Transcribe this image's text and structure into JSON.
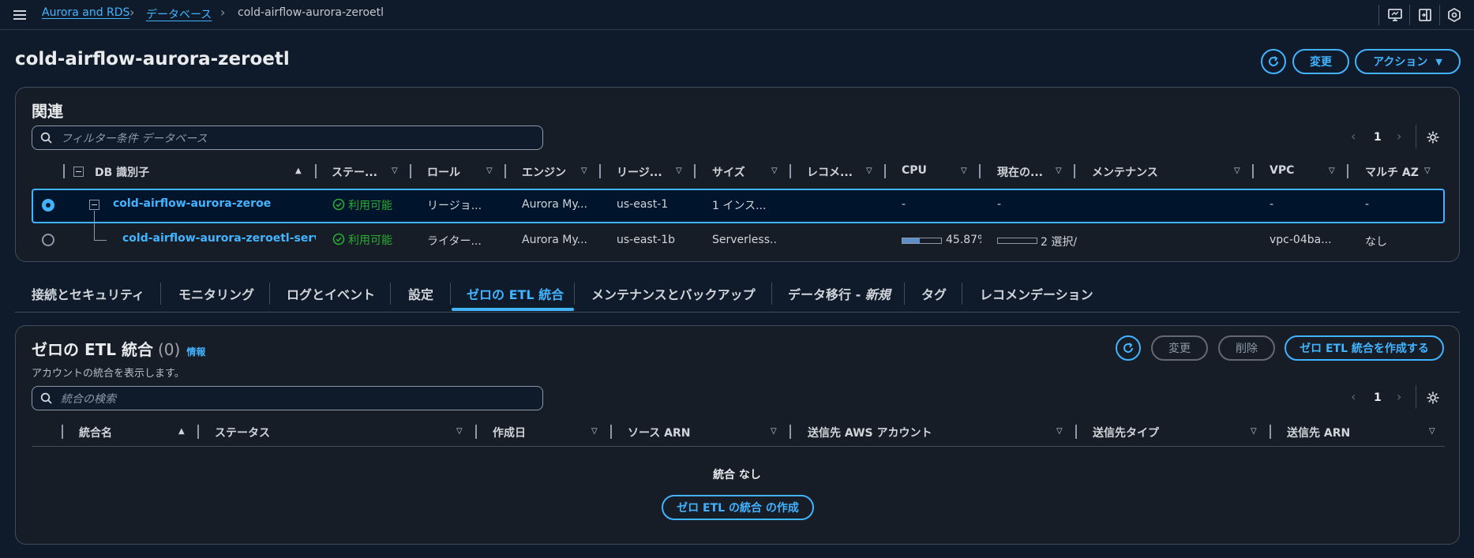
{
  "breadcrumb": {
    "items": [
      "Aurora and RDS",
      "データベース"
    ],
    "current": "cold-airflow-aurora-zeroetl"
  },
  "page": {
    "title": "cold-airflow-aurora-zeroetl",
    "modify_label": "変更",
    "actions_label": "アクション"
  },
  "related": {
    "title": "関連",
    "search_placeholder": "フィルター条件 データベース",
    "page_number": "1",
    "columns": [
      "DB 識別子",
      "ステー...",
      "ロール",
      "エンジン",
      "リージ...",
      "サイズ",
      "レコメ...",
      "CPU",
      "現在の...",
      "メンテナンス",
      "VPC",
      "マルチ AZ"
    ],
    "rows": [
      {
        "selected": true,
        "id": "cold-airflow-aurora-zeroetl",
        "status": "利用可能",
        "role": "リージョ...",
        "engine": "Aurora My...",
        "region": "us-east-1",
        "size": "1 インス...",
        "recommend": "",
        "cpu": "-",
        "current": "-",
        "maintenance": "",
        "vpc": "-",
        "multi_az": "-"
      },
      {
        "selected": false,
        "id": "cold-airflow-aurora-zeroetl-serverles",
        "status": "利用可能",
        "role": "ライター...",
        "engine": "Aurora My...",
        "region": "us-east-1b",
        "size": "Serverless...",
        "recommend": "",
        "cpu": "45.87%",
        "cpu_fraction": 0.4587,
        "current": "2 選択/",
        "current_fraction": 0.0,
        "maintenance": "",
        "vpc": "vpc-04ba...",
        "multi_az": "なし"
      }
    ]
  },
  "tabs": [
    {
      "label": "接続とセキュリティ",
      "active": false
    },
    {
      "label": "モニタリング",
      "active": false
    },
    {
      "label": "ログとイベント",
      "active": false
    },
    {
      "label": "設定",
      "active": false
    },
    {
      "label": "ゼロの ETL 統合",
      "active": true
    },
    {
      "label": "メンテナンスとバックアップ",
      "active": false
    },
    {
      "label": "データ移行 - ",
      "suffix": "新規",
      "active": false
    },
    {
      "label": "タグ",
      "active": false
    },
    {
      "label": "レコメンデーション",
      "active": false
    }
  ],
  "etl": {
    "title": "ゼロの ETL 統合",
    "count": "(0)",
    "info_label": "情報",
    "description": "アカウントの統合を表示します。",
    "modify_label": "変更",
    "delete_label": "削除",
    "create_label": "ゼロ ETL 統合を作成する",
    "search_placeholder": "統合の検索",
    "page_number": "1",
    "columns": [
      "統合名",
      "ステータス",
      "作成日",
      "ソース ARN",
      "送信先 AWS アカウント",
      "送信先タイプ",
      "送信先 ARN"
    ],
    "empty_text": "統合 なし",
    "empty_button": "ゼロ ETL の統合 の作成"
  },
  "colors": {
    "accent": "#42b4ff",
    "ok": "#29ad32",
    "background": "#0f1b2a",
    "panel": "#161d26"
  }
}
